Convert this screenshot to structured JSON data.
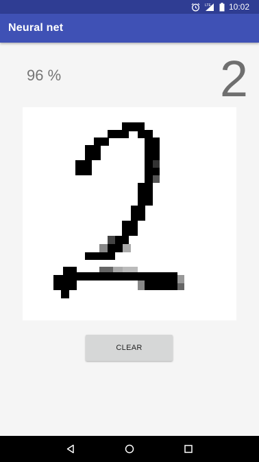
{
  "status_bar": {
    "time": "10:02",
    "network": "LTE",
    "icons": [
      "alarm-icon",
      "signal-icon",
      "battery-icon"
    ]
  },
  "app_bar": {
    "title": "Neural net",
    "color": "#3f51b5"
  },
  "result": {
    "confidence": "96 %",
    "digit": "2"
  },
  "drawing_canvas": {
    "content": "handwritten digit 2 pixel grid"
  },
  "actions": {
    "clear_label": "CLEAR"
  },
  "nav_bar": {
    "icons": [
      "back-icon",
      "home-icon",
      "recents-icon"
    ]
  }
}
